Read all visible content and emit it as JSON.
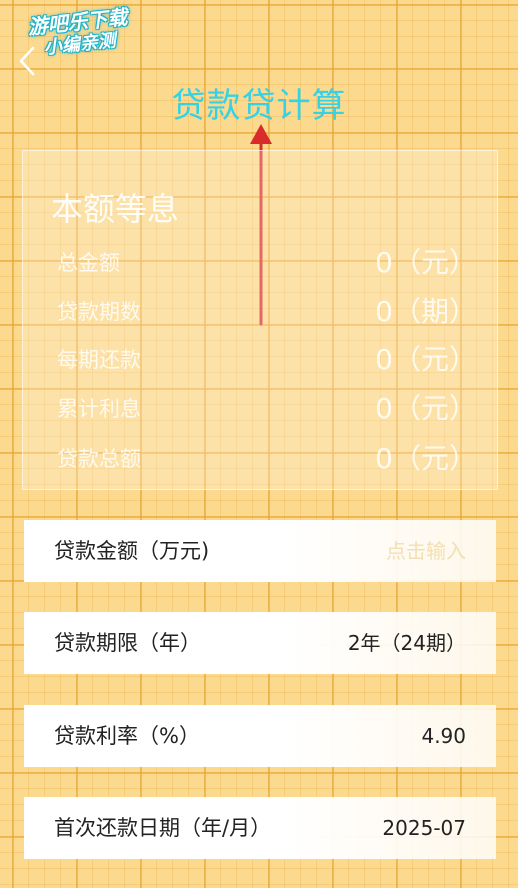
{
  "watermark": {
    "line1": "游吧乐下载",
    "line2": "小编亲测"
  },
  "icons": {
    "back": "chevron-left-icon",
    "annotation": "red-arrow-up"
  },
  "header": {
    "title": "贷款贷计算"
  },
  "colors": {
    "title": "#35d2e6",
    "grid_background": "#fbd98f",
    "annotation_arrow": "#d92b2b"
  },
  "summary": {
    "title": "本额等息",
    "rows": [
      {
        "label": "总金额",
        "value": "0（元）"
      },
      {
        "label": "贷款期数",
        "value": "0（期）"
      },
      {
        "label": "每期还款",
        "value": "0（元）"
      },
      {
        "label": "累计利息",
        "value": "0（元）"
      },
      {
        "label": "贷款总额",
        "value": "0（元）"
      }
    ]
  },
  "form": {
    "amount": {
      "label": "贷款金额（万元)",
      "placeholder": "点击输入"
    },
    "term": {
      "label": "贷款期限（年）",
      "value": "2年（24期）"
    },
    "rate": {
      "label": "贷款利率（%）",
      "value": "4.90"
    },
    "first_date": {
      "label": "首次还款日期（年/月）",
      "value": "2025-07"
    }
  }
}
